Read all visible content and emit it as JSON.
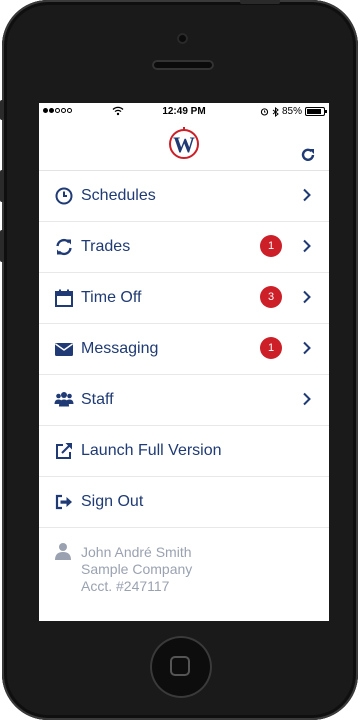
{
  "statusbar": {
    "time": "12:49 PM",
    "battery": "85%"
  },
  "header": {
    "logo_letter": "W"
  },
  "menu": [
    {
      "label": "Schedules",
      "icon": "clock-icon"
    },
    {
      "label": "Trades",
      "icon": "sync-icon",
      "badge": "1"
    },
    {
      "label": "Time Off",
      "icon": "calendar-icon",
      "badge": "3"
    },
    {
      "label": "Messaging",
      "icon": "envelope-icon",
      "badge": "1"
    },
    {
      "label": "Staff",
      "icon": "users-icon"
    },
    {
      "label": "Launch Full Version",
      "icon": "external-link-icon"
    },
    {
      "label": "Sign Out",
      "icon": "sign-out-icon"
    }
  ],
  "account": {
    "name": "John André Smith",
    "company": "Sample Company",
    "acct": "Acct. #247117"
  },
  "colors": {
    "accent": "#1f3a74",
    "badge": "#cc1f28",
    "muted": "#9aa2b1"
  }
}
